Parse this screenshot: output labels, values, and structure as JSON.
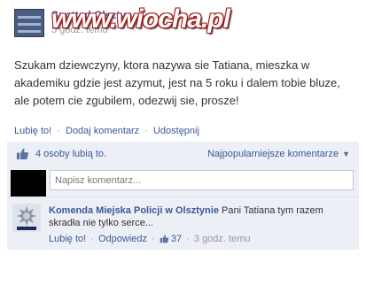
{
  "header": {
    "page_name": "Spotted Olsztyn",
    "time": "5 godz. temu",
    "watermark": "www.wiocha.pl"
  },
  "post": {
    "text": "Szukam dziewczyny, ktora nazywa sie Tatiana, mieszka w akademiku gdzie jest azymut, jest na 5 roku i dalem tobie bluze, ale potem cie zgubilem, odezwij sie, prosze!"
  },
  "actions": {
    "like": "Lubię to!",
    "comment": "Dodaj komentarz",
    "share": "Udostępnij",
    "sep": "·"
  },
  "feedback": {
    "likes_text": "4 osoby lubią to.",
    "sort_label": "Najpopularniejsze komentarze"
  },
  "composer": {
    "placeholder": "Napisz komentarz..."
  },
  "comment": {
    "author": "Komenda Miejska Policji w Olsztynie",
    "text": "Pani Tatiana tym razem skradła nie tylko serce...",
    "like": "Lubię to!",
    "reply": "Odpowiedz",
    "like_count": "37",
    "time": "3 godz. temu",
    "sep": "·"
  },
  "colors": {
    "link": "#3b5998",
    "feedback_bg": "#eceff5"
  }
}
